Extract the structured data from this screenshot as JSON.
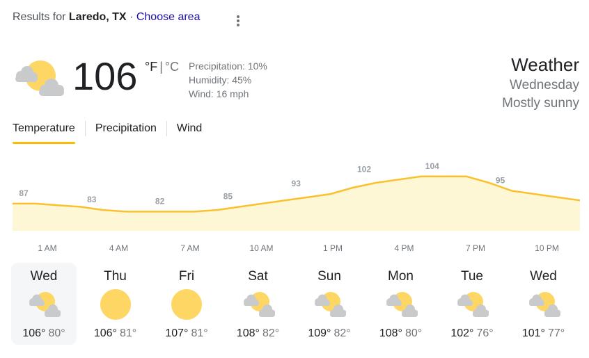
{
  "header": {
    "results_for": "Results for",
    "location": "Laredo, TX",
    "separator": "·",
    "choose_area": "Choose area",
    "menu_icon": "more-vert-icon"
  },
  "current": {
    "icon": "mostly-sunny-icon",
    "temperature": "106",
    "unit_f": "°F",
    "unit_sep": "|",
    "unit_c": "°C",
    "precipitation": "Precipitation: 10%",
    "humidity": "Humidity: 45%",
    "wind": "Wind: 16 mph"
  },
  "summary": {
    "title": "Weather",
    "day": "Wednesday",
    "condition": "Mostly sunny"
  },
  "tabs": [
    {
      "label": "Temperature",
      "active": true
    },
    {
      "label": "Precipitation",
      "active": false
    },
    {
      "label": "Wind",
      "active": false
    }
  ],
  "chart_data": {
    "type": "area",
    "x": [
      "1 AM",
      "4 AM",
      "7 AM",
      "10 AM",
      "1 PM",
      "4 PM",
      "7 PM",
      "10 PM"
    ],
    "labeled_values": [
      87,
      83,
      82,
      85,
      93,
      102,
      104,
      95
    ],
    "hourly_values": [
      87,
      87,
      86,
      85,
      83,
      82,
      82,
      82,
      82,
      83,
      85,
      87,
      89,
      91,
      93,
      97,
      100,
      102,
      104,
      104,
      104,
      100,
      95,
      93,
      91,
      89
    ],
    "ylim": [
      70,
      110
    ],
    "colors": {
      "line": "#fbc02d",
      "fill": "#fef7d6"
    }
  },
  "forecast": [
    {
      "day": "Wed",
      "icon": "mostly-sunny-icon",
      "high": "106°",
      "low": "80°",
      "active": true
    },
    {
      "day": "Thu",
      "icon": "sunny-icon",
      "high": "106°",
      "low": "81°",
      "active": false
    },
    {
      "day": "Fri",
      "icon": "sunny-icon",
      "high": "107°",
      "low": "81°",
      "active": false
    },
    {
      "day": "Sat",
      "icon": "mostly-sunny-icon",
      "high": "108°",
      "low": "82°",
      "active": false
    },
    {
      "day": "Sun",
      "icon": "mostly-sunny-icon",
      "high": "109°",
      "low": "82°",
      "active": false
    },
    {
      "day": "Mon",
      "icon": "mostly-sunny-icon",
      "high": "108°",
      "low": "80°",
      "active": false
    },
    {
      "day": "Tue",
      "icon": "mostly-sunny-icon",
      "high": "102°",
      "low": "76°",
      "active": false
    },
    {
      "day": "Wed",
      "icon": "mostly-sunny-icon",
      "high": "101°",
      "low": "77°",
      "active": false
    }
  ]
}
